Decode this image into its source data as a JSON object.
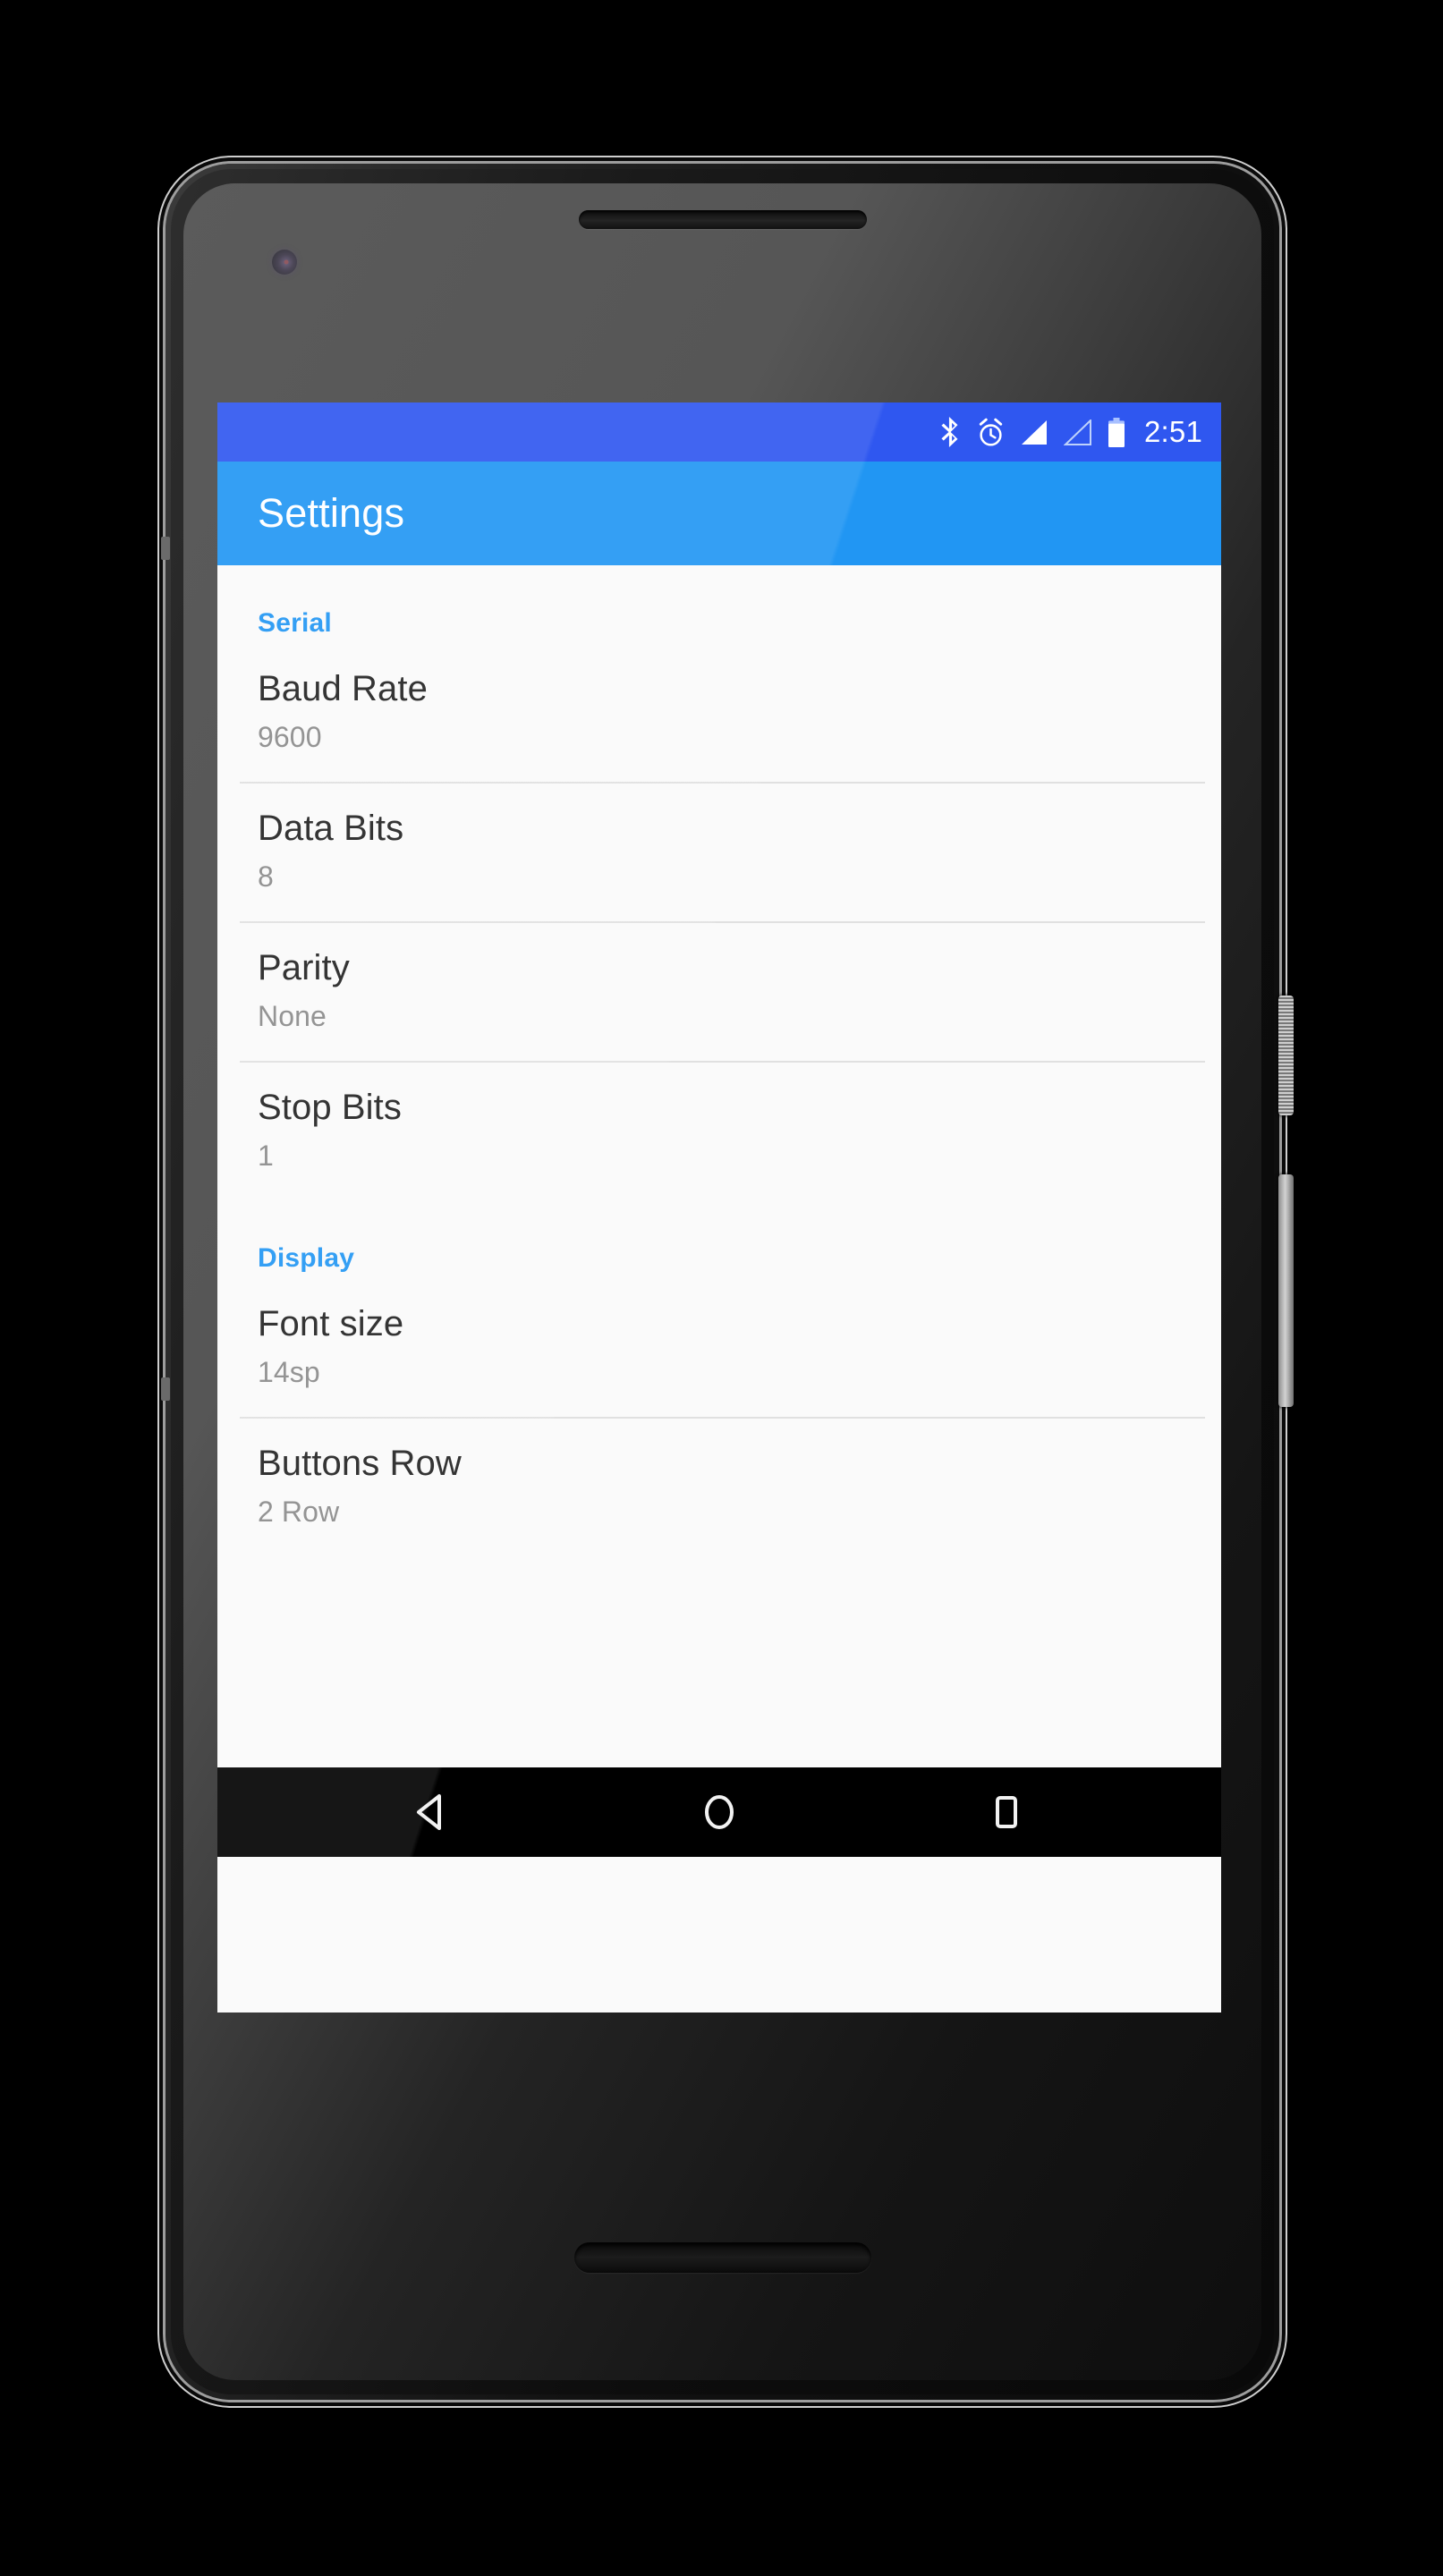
{
  "status_bar": {
    "time": "2:51",
    "icons": [
      {
        "name": "bluetooth-icon",
        "label": "Bluetooth"
      },
      {
        "name": "alarm-icon",
        "label": "Alarm set"
      },
      {
        "name": "signal-full-icon",
        "label": "Mobile signal"
      },
      {
        "name": "signal-empty-icon",
        "label": "Second SIM no signal"
      },
      {
        "name": "battery-icon",
        "label": "Battery"
      }
    ],
    "background_color": "#2F57F0"
  },
  "app_bar": {
    "title": "Settings",
    "background_color": "#2196F3",
    "text_color": "#FFFFFF"
  },
  "settings": {
    "accent_color": "#2196F3",
    "title_color": "#212121",
    "summary_color": "#8A8A8A",
    "background_color": "#FAFAFA",
    "sections": [
      {
        "header": "Serial",
        "items": [
          {
            "title": "Baud Rate",
            "summary": "9600",
            "divider_after": true
          },
          {
            "title": "Data Bits",
            "summary": "8",
            "divider_after": true
          },
          {
            "title": "Parity",
            "summary": "None",
            "divider_after": true
          },
          {
            "title": "Stop Bits",
            "summary": "1",
            "divider_after": false
          }
        ]
      },
      {
        "header": "Display",
        "items": [
          {
            "title": "Font size",
            "summary": "14sp",
            "divider_after": true
          },
          {
            "title": "Buttons Row",
            "summary": "2 Row",
            "divider_after": false
          }
        ]
      }
    ]
  },
  "nav_bar": {
    "background_color": "#000000",
    "buttons": [
      {
        "name": "nav-back-button",
        "label": "Back"
      },
      {
        "name": "nav-home-button",
        "label": "Home"
      },
      {
        "name": "nav-recents-button",
        "label": "Recent apps"
      }
    ]
  },
  "device": {
    "hardware": [
      {
        "name": "earpiece-speaker",
        "label": "Earpiece speaker"
      },
      {
        "name": "front-camera",
        "label": "Front camera"
      },
      {
        "name": "power-button",
        "label": "Power"
      },
      {
        "name": "volume-button",
        "label": "Volume rocker"
      },
      {
        "name": "bottom-speaker",
        "label": "Bottom speaker"
      }
    ]
  }
}
